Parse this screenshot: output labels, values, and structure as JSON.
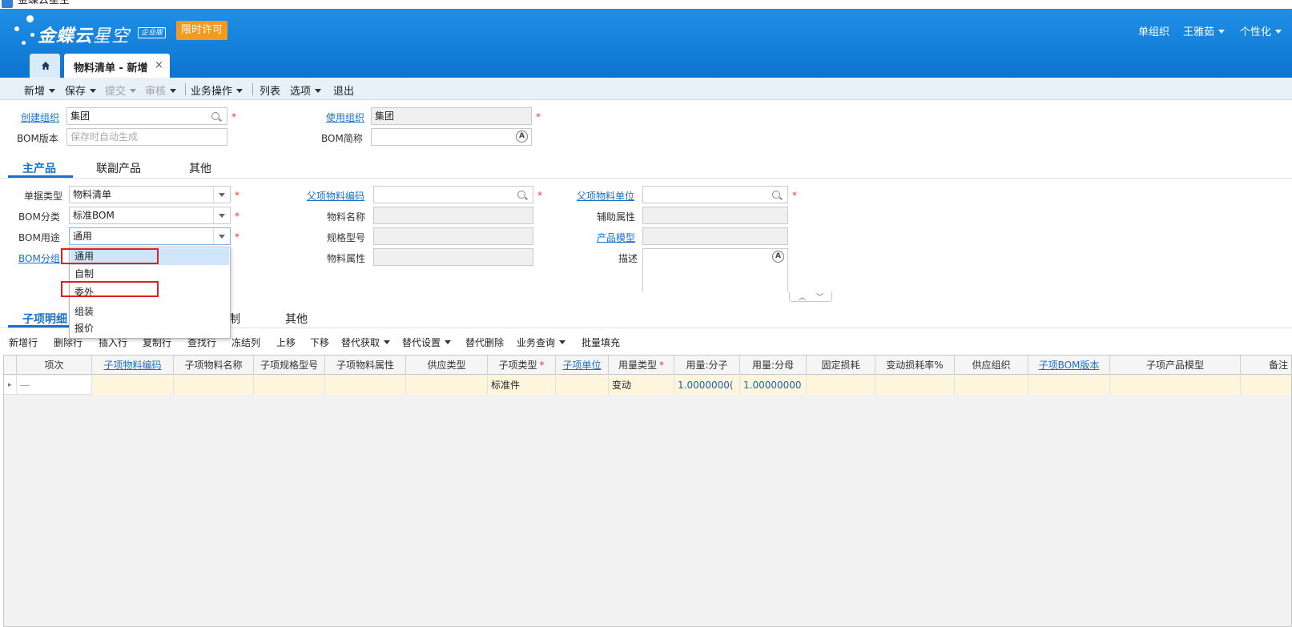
{
  "window": {
    "title": "金蝶云星空"
  },
  "header": {
    "logo_main": "金蝶云",
    "logo_sub": "星空",
    "edition": "企业版",
    "license": "限时许可",
    "org": "单组织",
    "user": "王雅茹",
    "personalize": "个性化",
    "doc_tab": "物料清单 - 新增",
    "doc_tab_close": "×"
  },
  "toolbar": {
    "new": "新增",
    "save": "保存",
    "submit": "提交",
    "audit": "审核",
    "business": "业务操作",
    "list": "列表",
    "options": "选项",
    "exit": "退出"
  },
  "form_top": {
    "create_org_label": "创建组织",
    "create_org_value": "集团",
    "use_org_label": "使用组织",
    "use_org_value": "集团",
    "bom_version_label": "BOM版本",
    "bom_version_placeholder": "保存时自动生成",
    "bom_short_label": "BOM简称",
    "required": "*",
    "multilang_icon": "A"
  },
  "tabs_main": [
    "主产品",
    "联副产品",
    "其他"
  ],
  "main_product": {
    "doc_type_label": "单据类型",
    "doc_type_value": "物料清单",
    "bom_class_label": "BOM分类",
    "bom_class_value": "标准BOM",
    "bom_use_label": "BOM用途",
    "bom_use_value": "通用",
    "bom_group_label": "BOM分组",
    "parent_code_label": "父项物料编码",
    "material_name_label": "物料名称",
    "spec_label": "规格型号",
    "material_attr_label": "物料属性",
    "parent_unit_label": "父项物料单位",
    "aux_attr_label": "辅助属性",
    "product_model_label": "产品模型",
    "desc_label": "描述"
  },
  "dropdown": {
    "options": [
      "通用",
      "自制",
      "委外",
      "组装",
      "报价"
    ],
    "selected": "通用"
  },
  "tabs_detail": {
    "active": "子项明细",
    "hidden_suffix": "制",
    "other": "其他"
  },
  "subtoolbar": [
    "新增行",
    "删除行",
    "插入行",
    "复制行",
    "查找行",
    "冻结列",
    "上移",
    "下移",
    "替代获取",
    "替代设置",
    "替代删除",
    "业务查询",
    "批量填充"
  ],
  "grid": {
    "columns": [
      "项次",
      "子项物料编码",
      "子项物料名称",
      "子项规格型号",
      "子项物料属性",
      "供应类型",
      "子项类型",
      "子项单位",
      "用量类型",
      "用量:分子",
      "用量:分母",
      "固定损耗",
      "变动损耗率%",
      "供应组织",
      "子项BOM版本",
      "子项产品模型",
      "备注"
    ],
    "row": {
      "item_type": "标准件",
      "usage_type": "变动",
      "numerator": "1.0000000(",
      "denominator": "1.00000000"
    }
  },
  "colors": {
    "header_blue": "#1f8fe6",
    "accent": "#1a6fc9",
    "license_orange": "#f39a1e",
    "required_red": "#e53935"
  }
}
